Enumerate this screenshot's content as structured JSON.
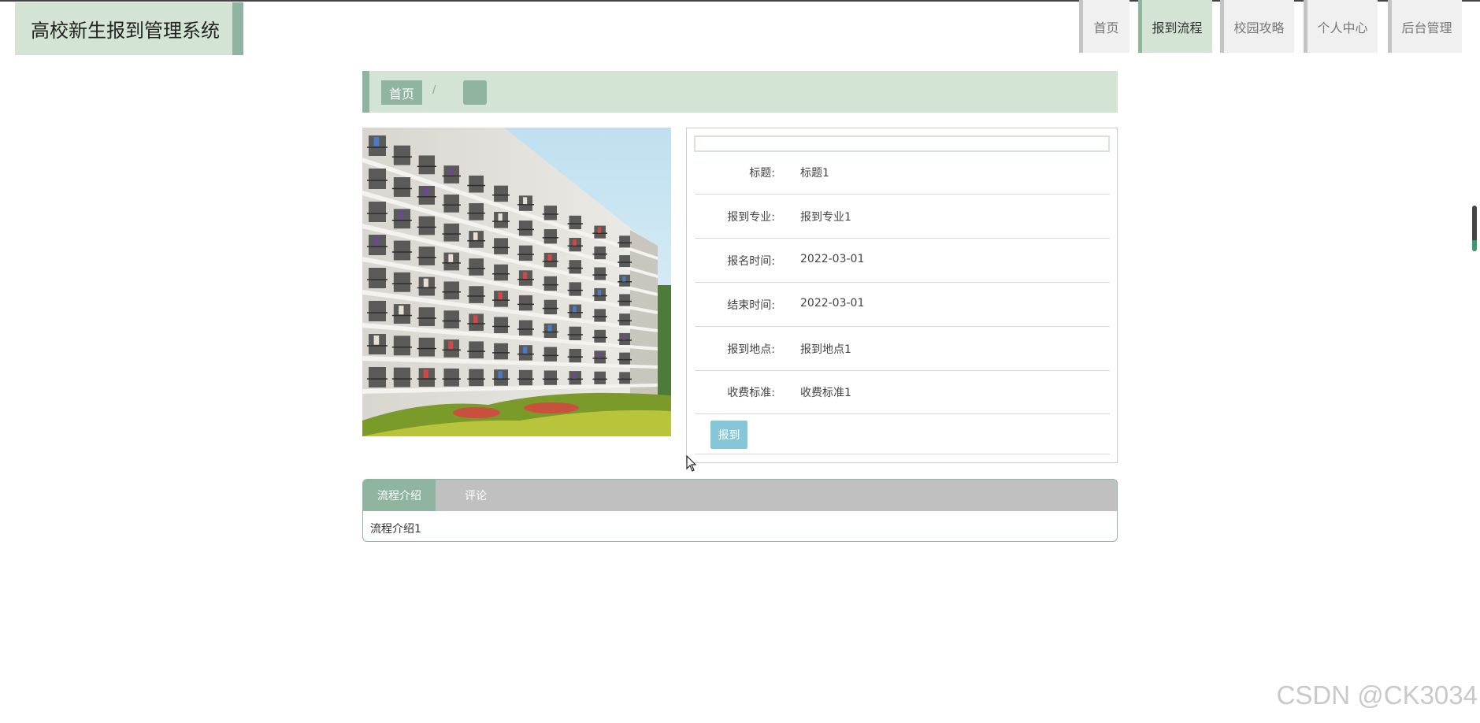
{
  "app": {
    "title": "高校新生报到管理系统"
  },
  "nav": {
    "items": [
      {
        "label": "首页",
        "active": false
      },
      {
        "label": "报到流程",
        "active": true
      },
      {
        "label": "校园攻略",
        "active": false
      },
      {
        "label": "个人中心",
        "active": false
      },
      {
        "label": "后台管理",
        "active": false
      }
    ]
  },
  "breadcrumb": {
    "home": "首页",
    "separator": "/",
    "current": ""
  },
  "detail": {
    "input_value": "",
    "fields": [
      {
        "label": "标题:",
        "value": "标题1"
      },
      {
        "label": "报到专业:",
        "value": "报到专业1"
      },
      {
        "label": "报名时间:",
        "value": "2022-03-01"
      },
      {
        "label": "结束时间:",
        "value": "2022-03-01"
      },
      {
        "label": "报到地点:",
        "value": "报到地点1"
      },
      {
        "label": "收费标准:",
        "value": "收费标准1"
      }
    ],
    "action_label": "报到"
  },
  "tabs": {
    "items": [
      {
        "label": "流程介绍",
        "active": true
      },
      {
        "label": "评论",
        "active": false
      }
    ],
    "content": "流程介绍1"
  },
  "watermark": "CSDN @CK3034",
  "colors": {
    "accent": "#8fb5a0",
    "accent_light": "#d3e4d4",
    "button": "#86c6d6",
    "tab_bar": "#c0c0c0"
  }
}
